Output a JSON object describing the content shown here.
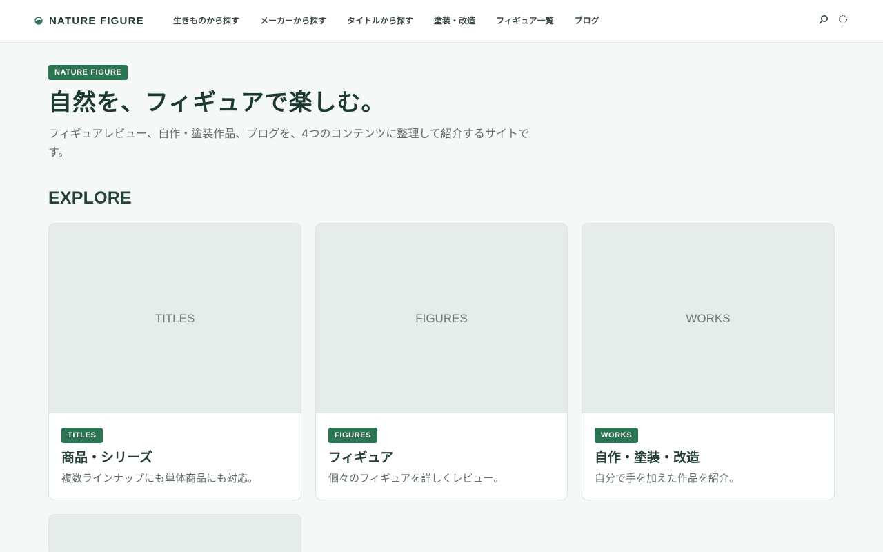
{
  "header": {
    "brand": "NATURE FIGURE",
    "brand_icon": "leaf-circle-icon",
    "nav": [
      {
        "label": "生きものから探す"
      },
      {
        "label": "メーカーから探す"
      },
      {
        "label": "タイトルから探す"
      },
      {
        "label": "塗装・改造"
      },
      {
        "label": "フィギュア一覧"
      },
      {
        "label": "ブログ"
      }
    ],
    "icons": [
      "search-icon",
      "theme-toggle-icon"
    ]
  },
  "hero": {
    "badge": "NATURE FIGURE",
    "title": "自然を、フィギュアで楽しむ。",
    "description": "フィギュアレビュー、自作・塗装作品、ブログを、4つのコンテンツに整理して紹介するサイトです。"
  },
  "explore": {
    "heading": "EXPLORE",
    "cards": [
      {
        "thumb": "TITLES",
        "badge": "TITLES",
        "title": "商品・シリーズ",
        "description": "複数ラインナップにも単体商品にも対応。"
      },
      {
        "thumb": "FIGURES",
        "badge": "FIGURES",
        "title": "フィギュア",
        "description": "個々のフィギュアを詳しくレビュー。"
      },
      {
        "thumb": "WORKS",
        "badge": "WORKS",
        "title": "自作・塗装・改造",
        "description": "自分で手を加えた作品を紹介。"
      }
    ]
  },
  "colors": {
    "accent": "#2c7553",
    "background": "#f4f8f6",
    "heading": "#1d3a30",
    "muted_text": "#5f6d67",
    "thumb": "#e6ece9"
  }
}
